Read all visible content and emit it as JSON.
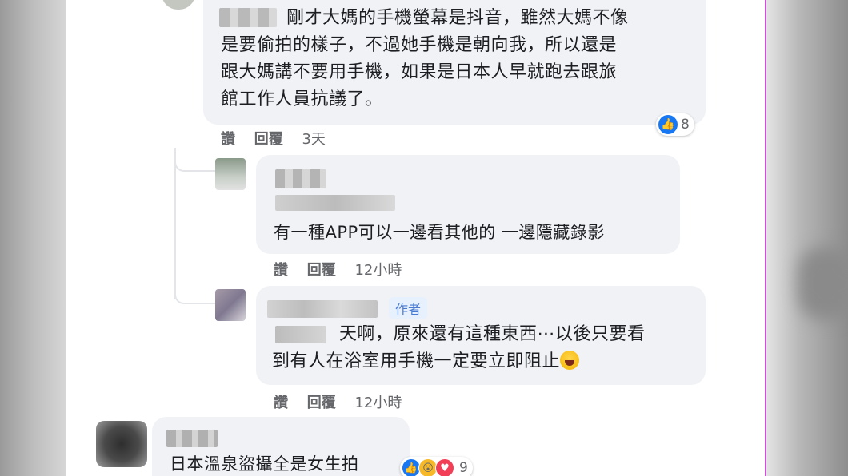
{
  "comments": [
    {
      "text_lines": [
        "剛才大媽的手機螢幕是抖音，雖然大媽不像",
        "是要偷拍的樣子，不過她手機是朝向我，所以還是",
        "跟大媽講不要用手機，如果是日本人早就跑去跟旅",
        "館工作人員抗議了。"
      ],
      "reactions": {
        "count": "8",
        "icons": [
          "like-icon"
        ]
      },
      "actions": {
        "like": "讚",
        "reply": "回覆",
        "time": "3天"
      }
    },
    {
      "text": "有一種APP可以一邊看其他的 一邊隱藏錄影",
      "actions": {
        "like": "讚",
        "reply": "回覆",
        "time": "12小時"
      }
    },
    {
      "author_tag": "作者",
      "text_lines": [
        "天啊，原來還有這種東西⋯以後只要看",
        "到有人在浴室用手機一定要立即阻止"
      ],
      "emoji": "laughing-face",
      "actions": {
        "like": "讚",
        "reply": "回覆",
        "time": "12小時"
      }
    },
    {
      "text": "日本溫泉盜攝全是女生拍",
      "reactions": {
        "count": "9",
        "icons": [
          "like-icon",
          "wow-icon",
          "love-icon"
        ]
      }
    }
  ],
  "colors": {
    "bubble": "#f0f2f5",
    "action_text": "#65676b",
    "like_blue": "#1877f2",
    "tag_bg": "#e7f0fd"
  }
}
